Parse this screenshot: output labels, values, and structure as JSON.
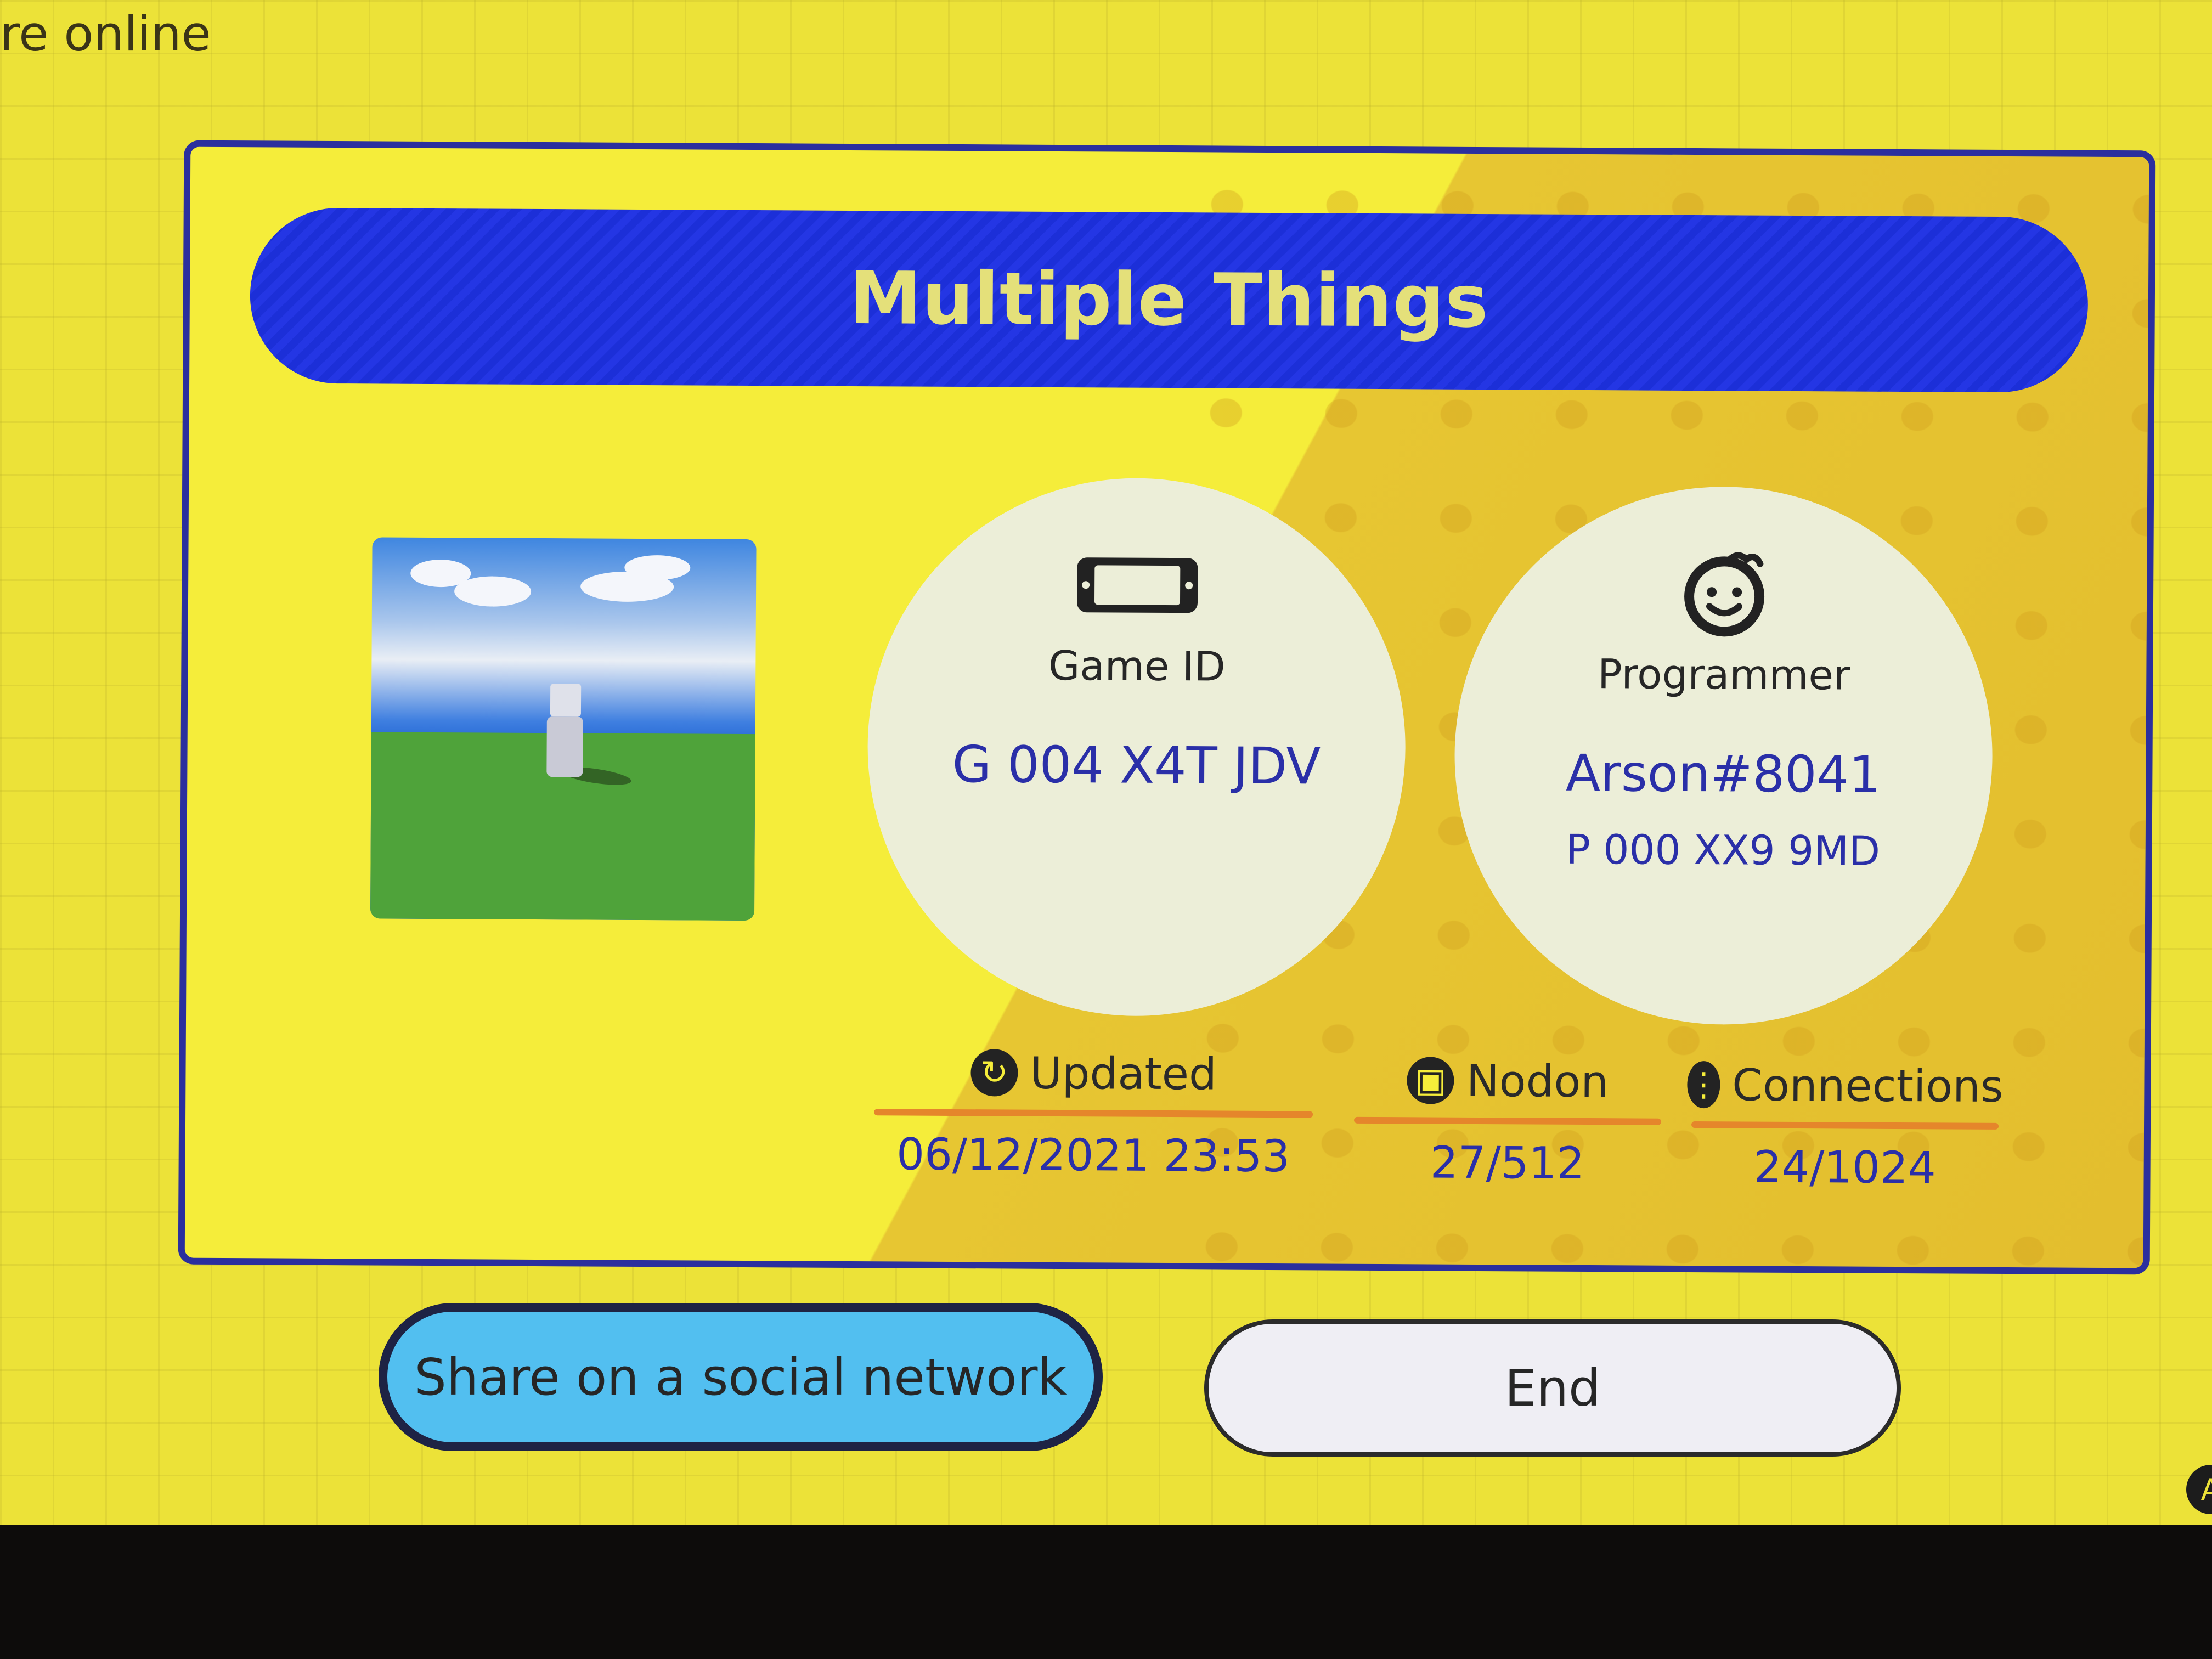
{
  "corner_status": "re online",
  "game": {
    "title": "Multiple Things"
  },
  "info": {
    "game_id_label": "Game ID",
    "game_id_value": "G 004 X4T JDV",
    "programmer_label": "Programmer",
    "programmer_name": "Arson#8041",
    "programmer_id": "P 000 XX9 9MD"
  },
  "stats": {
    "updated_label": "Updated",
    "updated_value": "06/12/2021 23:53",
    "nodon_label": "Nodon",
    "nodon_value": "27/512",
    "connections_label": "Connections",
    "connections_value": "24/1024"
  },
  "buttons": {
    "share_label": "Share on a social network",
    "end_label": "End",
    "a_glyph": "A"
  },
  "colors": {
    "background": "#ece238",
    "title_bar": "#1c2fd8",
    "title_text": "#e4e07a",
    "value_text": "#2a2fa8",
    "stat_rule": "#e5862b",
    "share_button": "#52bff0"
  },
  "icons": {
    "game_id": "console-icon",
    "programmer": "smiley-face-icon",
    "updated": "refresh-icon",
    "nodon": "nodon-icon",
    "connections": "connection-icon"
  }
}
